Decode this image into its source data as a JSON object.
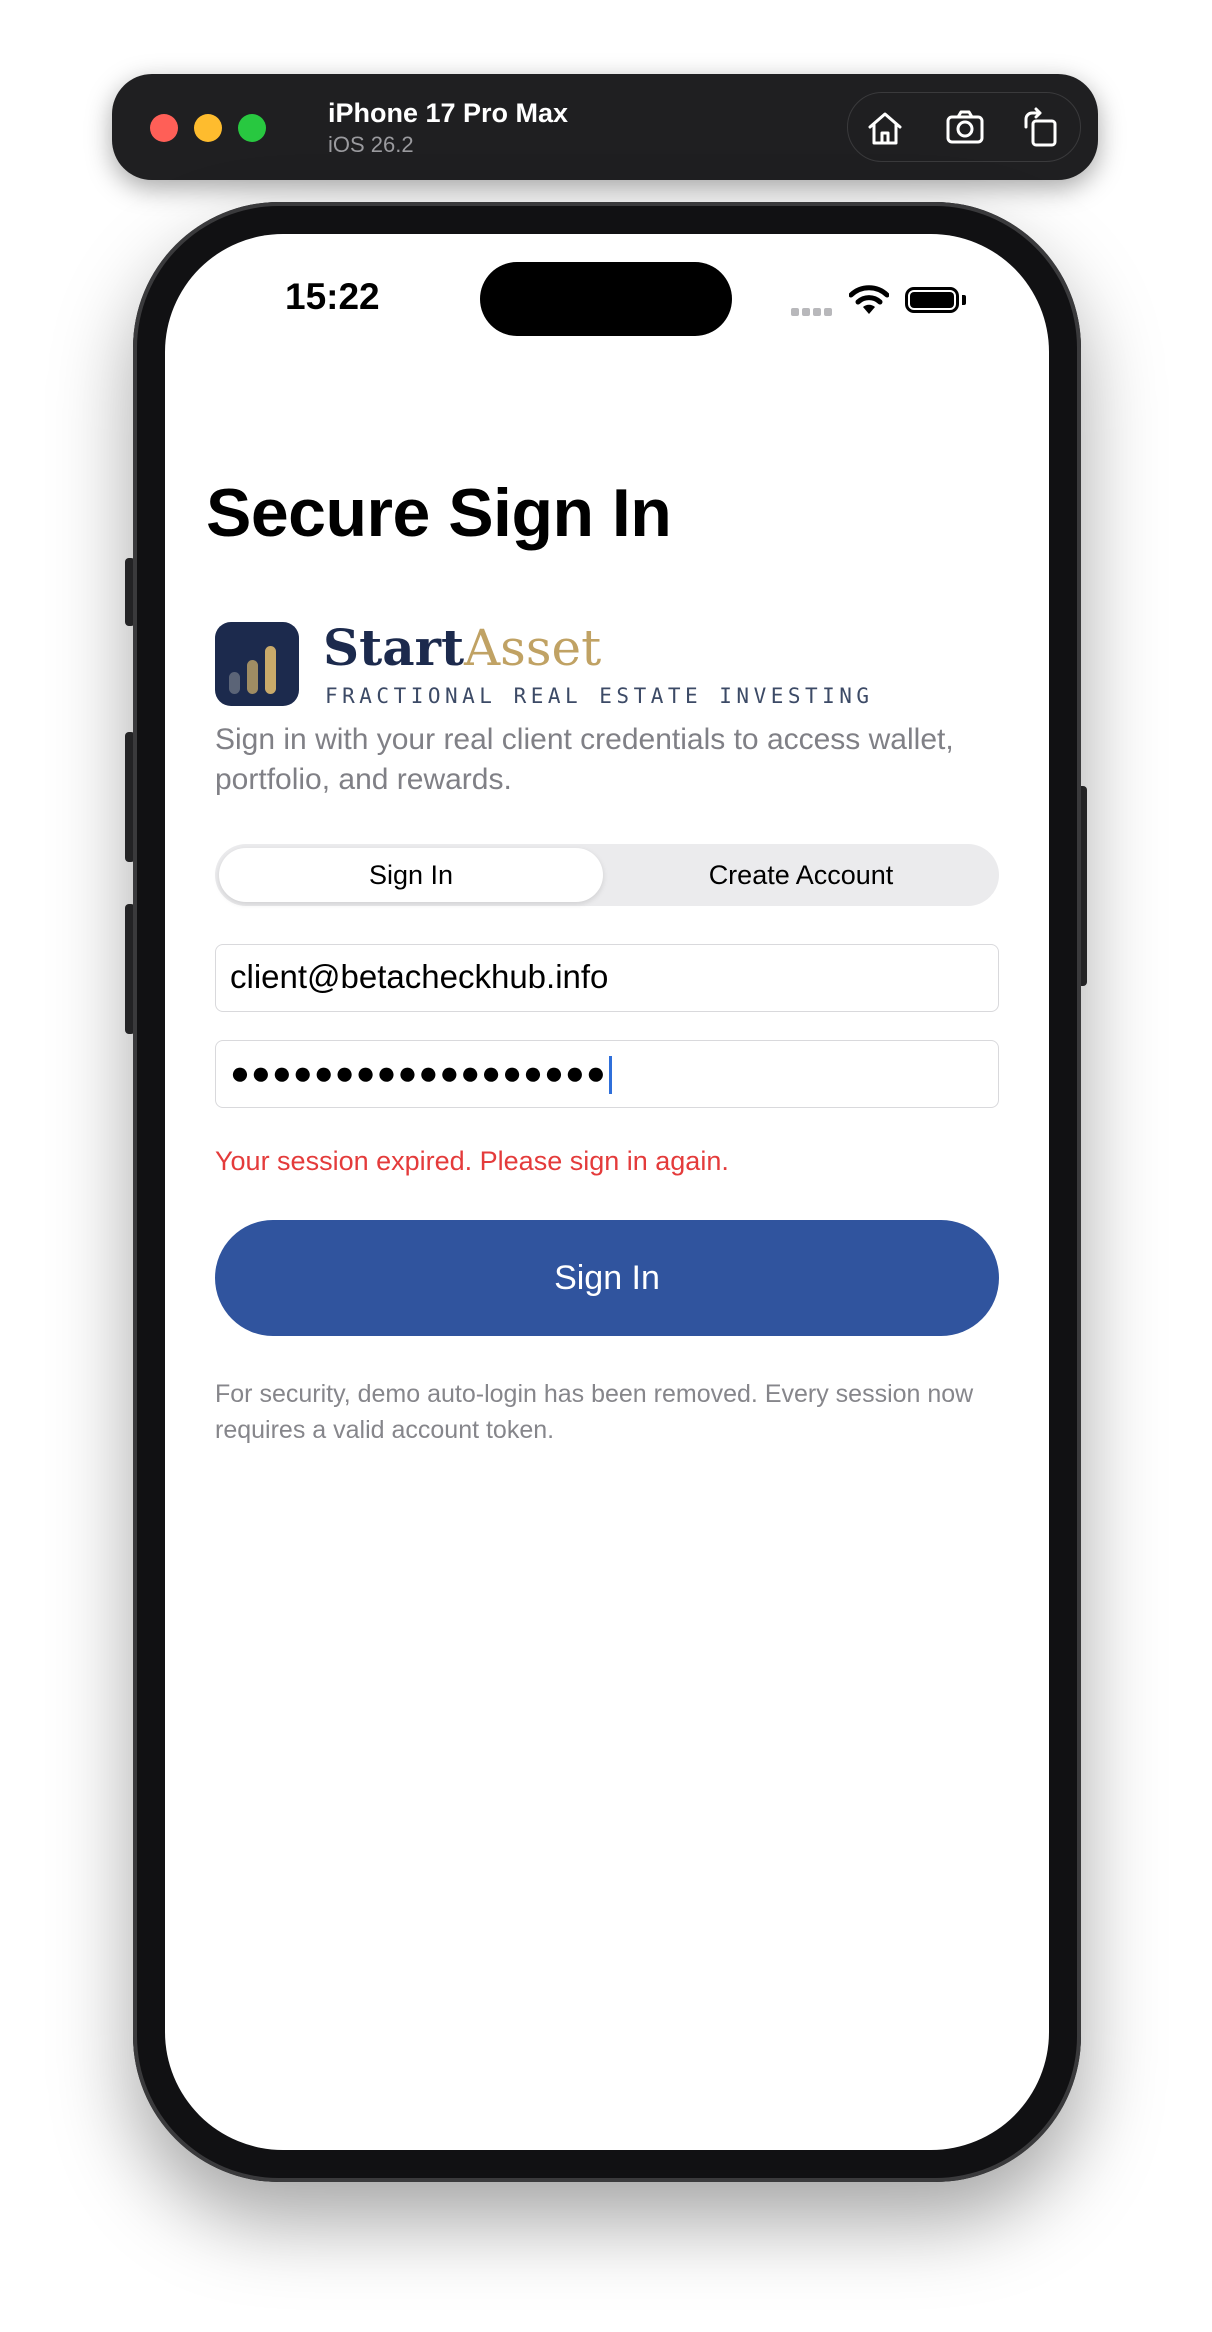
{
  "simulator": {
    "device_name": "iPhone 17 Pro Max",
    "os_version": "iOS 26.2",
    "actions": [
      "home-icon",
      "screenshot-icon",
      "rotate-icon"
    ]
  },
  "status_bar": {
    "time": "15:22"
  },
  "screen": {
    "title": "Secure Sign In",
    "brand": {
      "name_part1": "Start",
      "name_part2": "Asset",
      "tagline": "FRACTIONAL REAL ESTATE INVESTING",
      "colors": {
        "navy": "#1c2a4d",
        "gold": "#c0a264"
      }
    },
    "intro": "Sign in with your real client credentials to access wallet, portfolio, and rewards.",
    "segments": {
      "signin": "Sign In",
      "create": "Create Account",
      "selected": "Sign In"
    },
    "email_value": "client@betacheckhub.info",
    "password_mask": "●●●●●●●●●●●●●●●●●●",
    "error": "Your session expired. Please sign in again.",
    "primary_button": "Sign In",
    "footnote": "For security, demo auto-login has been removed. Every session now requires a valid account token.",
    "colors": {
      "primary": "#30549e",
      "error": "#e43b3b"
    }
  }
}
